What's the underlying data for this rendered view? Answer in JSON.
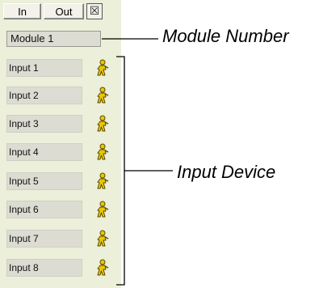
{
  "panel": {
    "tabs": [
      {
        "label": "In"
      },
      {
        "label": "Out"
      }
    ],
    "close_glyph": "☒",
    "module_field": "Module 1",
    "inputs": [
      {
        "label": "Input 1",
        "icon": "person-icon"
      },
      {
        "label": "Input 2",
        "icon": "person-icon"
      },
      {
        "label": "Input 3",
        "icon": "person-icon"
      },
      {
        "label": "Input 4",
        "icon": "person-icon"
      },
      {
        "label": "Input 5",
        "icon": "person-icon"
      },
      {
        "label": "Input 6",
        "icon": "person-icon"
      },
      {
        "label": "Input 7",
        "icon": "person-icon"
      },
      {
        "label": "Input 8",
        "icon": "person-icon"
      }
    ]
  },
  "annotations": {
    "module_number": "Module Number",
    "input_device": "Input Device"
  },
  "colors": {
    "panel_bg": "#ecefd9",
    "field_bg": "#dddcd3",
    "icon_yellow": "#e8c800",
    "icon_outline": "#5a4a00"
  }
}
